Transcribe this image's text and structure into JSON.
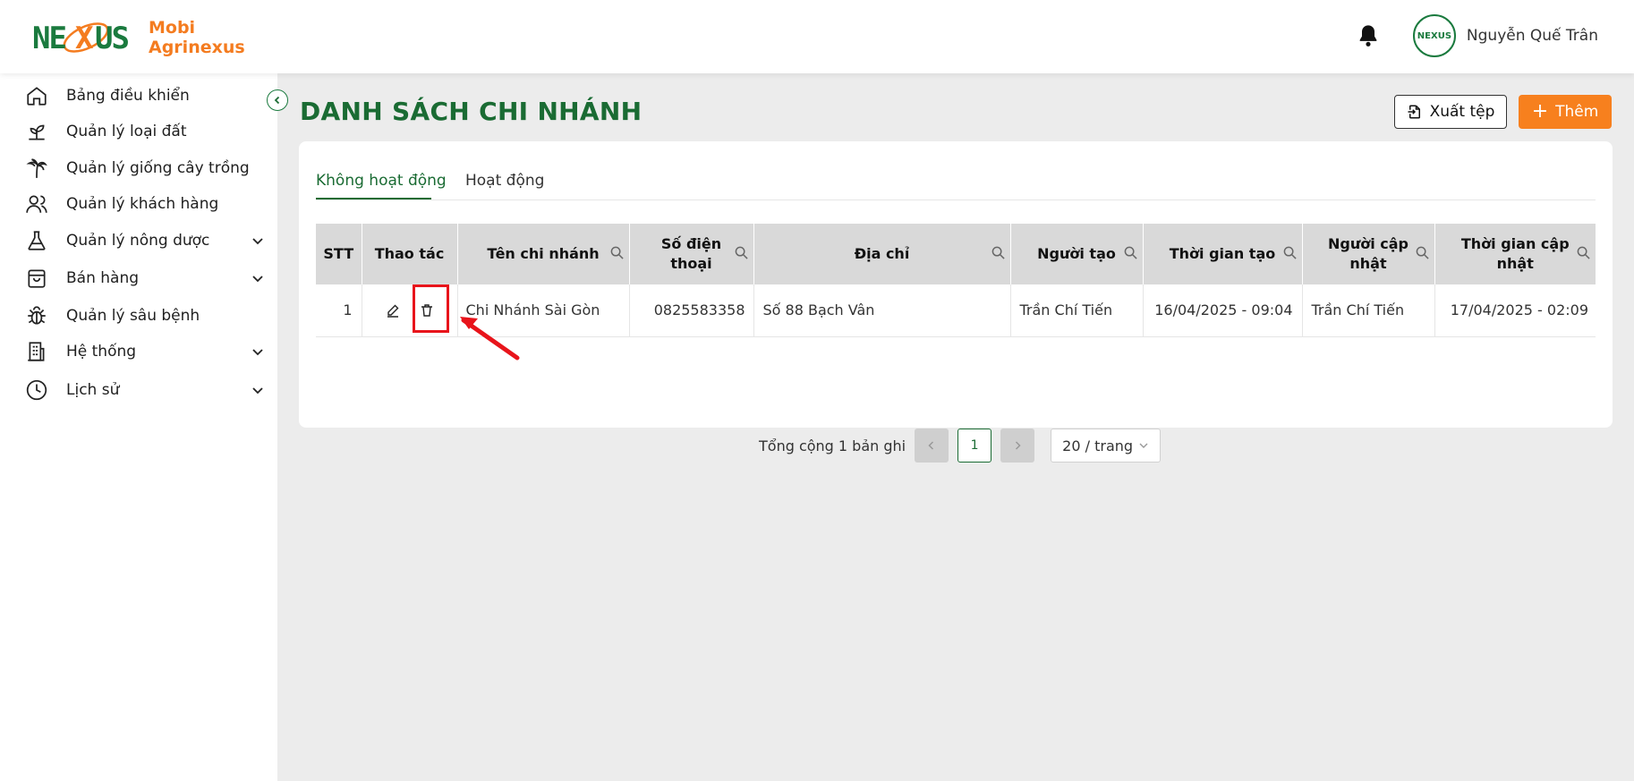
{
  "brand": {
    "logo_word": "NEXUS",
    "line1": "Mobi",
    "line2": "Agrinexus",
    "primary": "#1a6b33",
    "accent": "#f47c20"
  },
  "header": {
    "user_name": "Nguyễn Quế Trân",
    "avatar_text": "NEXUS",
    "notification_icon": "bell-icon"
  },
  "sidebar": {
    "items": [
      {
        "label": "Bảng điều khiển",
        "icon": "home-icon",
        "expandable": false
      },
      {
        "label": "Quản lý loại đất",
        "icon": "sprout-icon",
        "expandable": false
      },
      {
        "label": "Quản lý giống cây trồng",
        "icon": "palm-tree-icon",
        "expandable": false
      },
      {
        "label": "Quản lý khách hàng",
        "icon": "users-icon",
        "expandable": false
      },
      {
        "label": "Quản lý nông dược",
        "icon": "flask-icon",
        "expandable": true
      },
      {
        "label": "Bán hàng",
        "icon": "shopping-bag-icon",
        "expandable": true
      },
      {
        "label": "Quản lý sâu bệnh",
        "icon": "bug-icon",
        "expandable": false
      },
      {
        "label": "Hệ thống",
        "icon": "building-icon",
        "expandable": true
      },
      {
        "label": "Lịch sử",
        "icon": "clock-icon",
        "expandable": true
      }
    ]
  },
  "page": {
    "title": "DANH SÁCH CHI NHÁNH",
    "export_label": "Xuất tệp",
    "add_label": "Thêm"
  },
  "tabs": [
    {
      "label": "Không hoạt động",
      "active": true
    },
    {
      "label": "Hoạt động",
      "active": false
    }
  ],
  "table": {
    "columns": [
      "STT",
      "Thao tác",
      "Tên chi nhánh",
      "Số điện thoại",
      "Địa chỉ",
      "Người tạo",
      "Thời gian tạo",
      "Người cập nhật",
      "Thời gian cập nhật"
    ],
    "rows": [
      {
        "stt": "1",
        "name": "Chi Nhánh Sài Gòn",
        "phone": "0825583358",
        "address": "Số 88 Bạch Vân",
        "creator": "Trần Chí Tiến",
        "created_at": "16/04/2025 - 09:04",
        "updater": "Trần Chí Tiến",
        "updated_at": "17/04/2025 - 02:09"
      }
    ]
  },
  "pagination": {
    "total_text": "Tổng cộng 1 bản ghi",
    "current_page": "1",
    "page_size": "20 / trang"
  }
}
